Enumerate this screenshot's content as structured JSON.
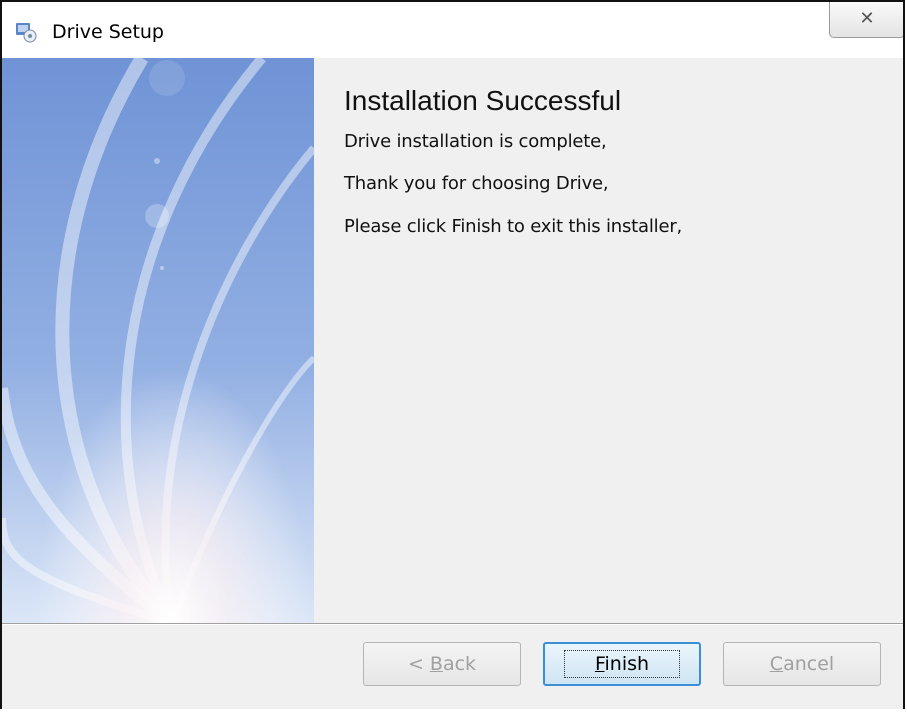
{
  "window": {
    "title": "Drive Setup",
    "close_glyph": "✕",
    "icon": "setup-app-icon"
  },
  "main": {
    "heading": "Installation Successful",
    "lines": [
      "Drive installation is complete,",
      "Thank you for choosing Drive,",
      "Please click Finish to exit this installer,"
    ]
  },
  "buttons": {
    "back": {
      "accel": "B",
      "rest": "ack",
      "prefix": "< ",
      "state": "disabled"
    },
    "finish": {
      "accel": "F",
      "rest": "inish",
      "state": "default"
    },
    "cancel": {
      "accel": "C",
      "rest": "ancel",
      "state": "disabled"
    }
  },
  "colors": {
    "banner_top": "#6f93d6",
    "banner_bottom": "#d6e3f6",
    "focus_border": "#3b8fd6",
    "dialog_bg": "#f0f0f0"
  }
}
